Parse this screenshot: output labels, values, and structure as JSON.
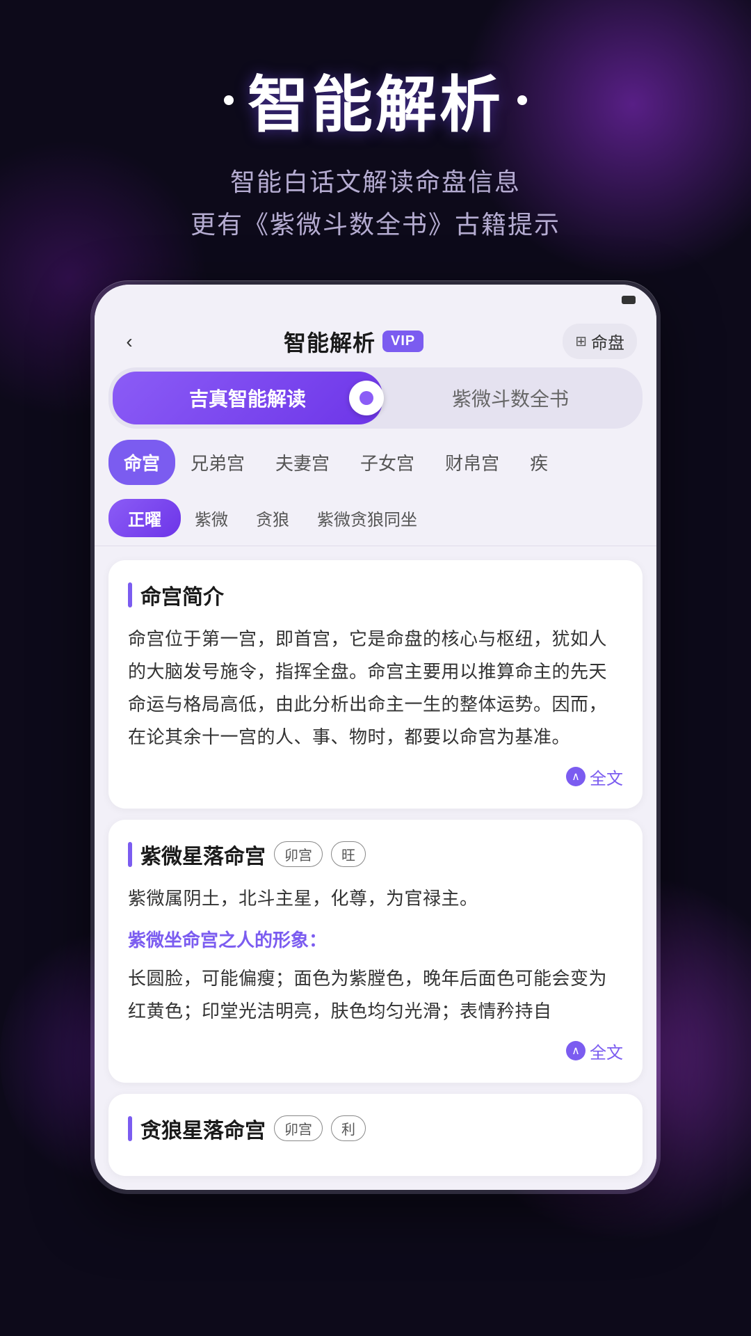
{
  "background": {
    "color": "#0d0a1a"
  },
  "header": {
    "title_dot_left": "•",
    "title_dot_right": "•",
    "main_title": "智能解析",
    "subtitle_line1": "智能白话文解读命盘信息",
    "subtitle_line2": "更有《紫微斗数全书》古籍提示"
  },
  "app": {
    "nav": {
      "back_label": "‹",
      "title": "智能解析",
      "vip_label": "VIP",
      "mingpan_icon": "⊞",
      "mingpan_label": "命盘"
    },
    "toggle": {
      "active_label": "吉真智能解读",
      "inactive_label": "紫微斗数全书"
    },
    "category_tabs": [
      {
        "label": "命宫",
        "active": true
      },
      {
        "label": "兄弟宫",
        "active": false
      },
      {
        "label": "夫妻宫",
        "active": false
      },
      {
        "label": "子女宫",
        "active": false
      },
      {
        "label": "财帛宫",
        "active": false
      },
      {
        "label": "疾",
        "active": false
      }
    ],
    "sub_tabs": [
      {
        "label": "正曜",
        "active": true
      },
      {
        "label": "紫微",
        "active": false
      },
      {
        "label": "贪狼",
        "active": false
      },
      {
        "label": "紫微贪狼同坐",
        "active": false
      }
    ],
    "cards": [
      {
        "id": "card1",
        "title": "命宫简介",
        "badges": [],
        "body": "命宫位于第一宫，即首宫，它是命盘的核心与枢纽，犹如人的大脑发号施令，指挥全盘。命宫主要用以推算命主的先天命运与格局高低，由此分析出命主一生的整体运势。因而，在论其余十一宫的人、事、物时，都要以命宫为基准。",
        "purple_label": "",
        "purple_body": "",
        "read_more": "全文"
      },
      {
        "id": "card2",
        "title": "紫微星落命宫",
        "badges": [
          "卯宫",
          "旺"
        ],
        "body": "紫微属阴土，北斗主星，化尊，为官禄主。",
        "purple_label": "紫微坐命宫之人的形象：",
        "purple_body": "长圆脸，可能偏瘦；面色为紫膛色，晚年后面色可能会变为红黄色；印堂光洁明亮，肤色均匀光滑；表情矜持自",
        "read_more": "全文"
      },
      {
        "id": "card3",
        "title": "贪狼星落命宫",
        "badges": [
          "卯宫",
          "利"
        ],
        "body": "",
        "purple_label": "",
        "purple_body": "",
        "read_more": ""
      }
    ]
  }
}
